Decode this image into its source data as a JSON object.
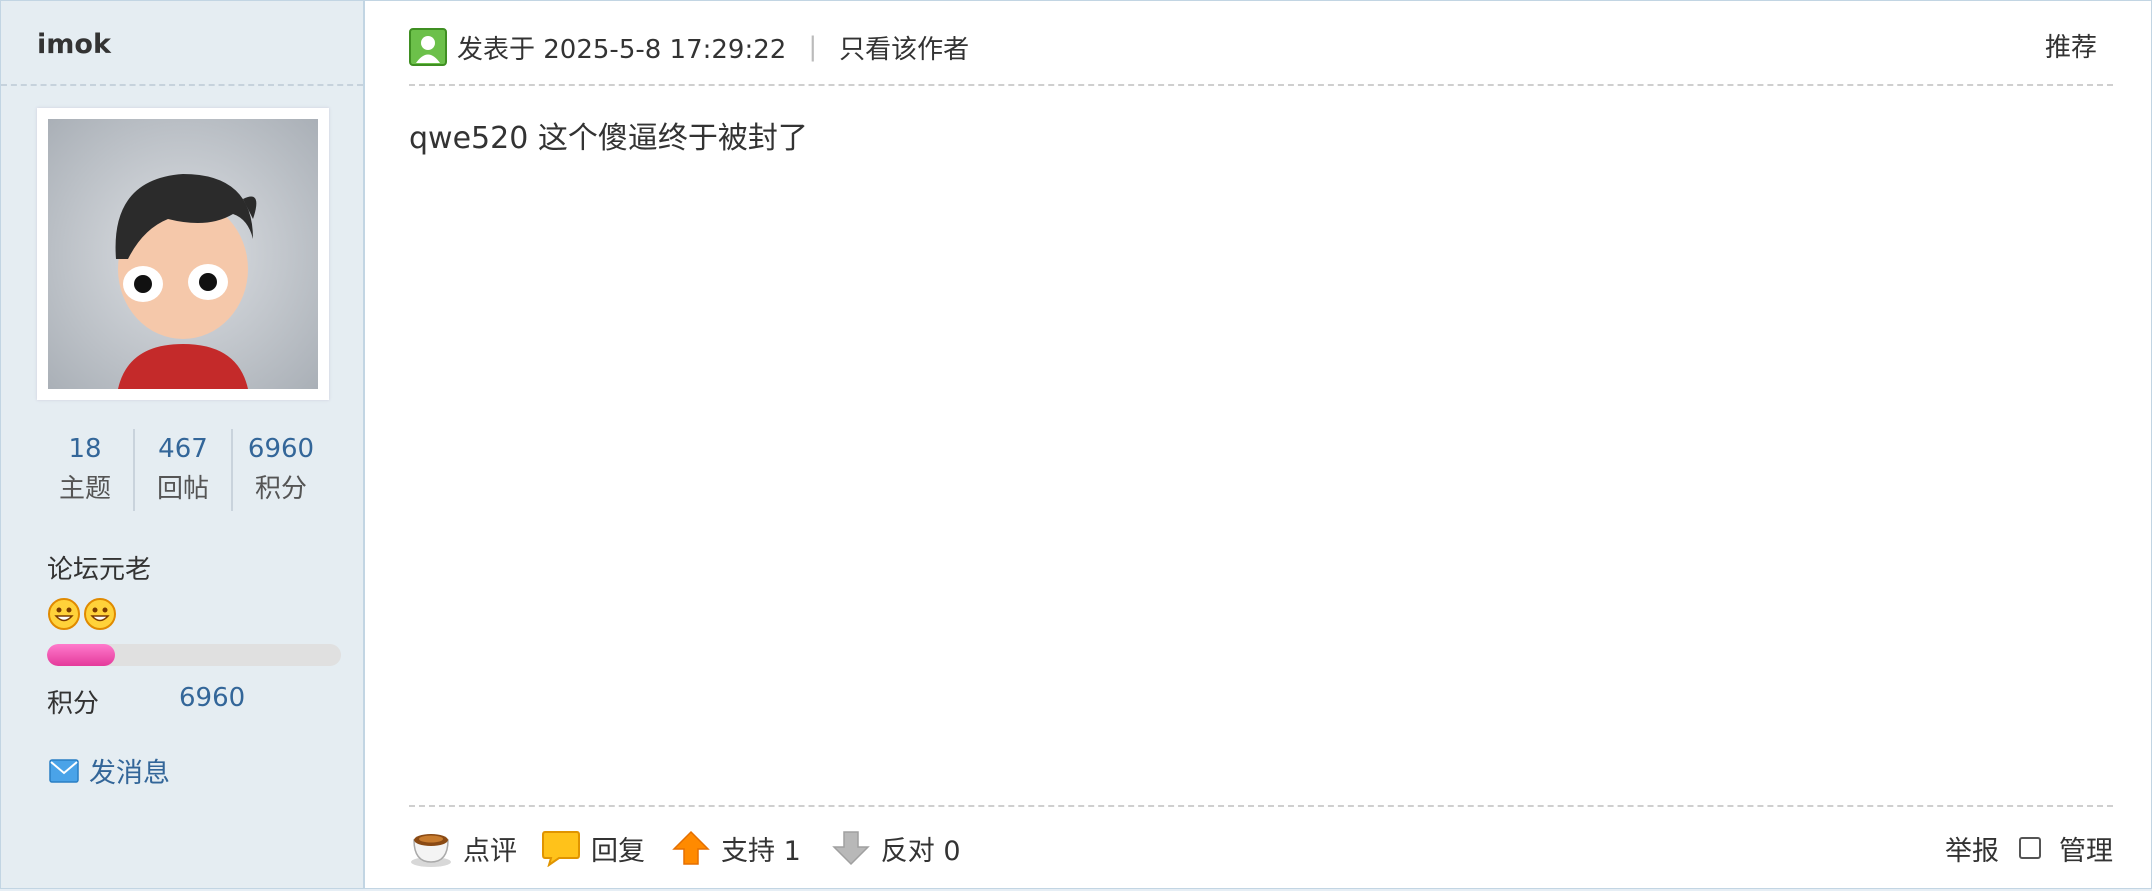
{
  "author": {
    "username": "imok",
    "stats": [
      {
        "value": "18",
        "label": "主题"
      },
      {
        "value": "467",
        "label": "回帖"
      },
      {
        "value": "6960",
        "label": "积分"
      }
    ],
    "rank": "论坛元老",
    "level_progress_percent": 23,
    "points_label": "积分",
    "points_value": "6960",
    "send_message": "发消息"
  },
  "post": {
    "posted_at": "发表于 2025-5-8 17:29:22",
    "separator": "|",
    "only_author": "只看该作者",
    "recommend": "推荐",
    "content": "qwe520 这个傻逼终于被封了"
  },
  "actions": {
    "comment": "点评",
    "reply": "回复",
    "support": "支持 1",
    "oppose": "反对 0",
    "report": "举报",
    "manage": "管理"
  },
  "colors": {
    "sidebar_bg": "#e5edf2",
    "link_blue": "#336699",
    "progress_pink": "#e43a9b"
  },
  "icons": [
    "user-icon",
    "envelope-icon",
    "coffee-cup-icon",
    "chat-bubble-icon",
    "up-arrow-icon",
    "down-arrow-icon",
    "smiley-icon"
  ]
}
